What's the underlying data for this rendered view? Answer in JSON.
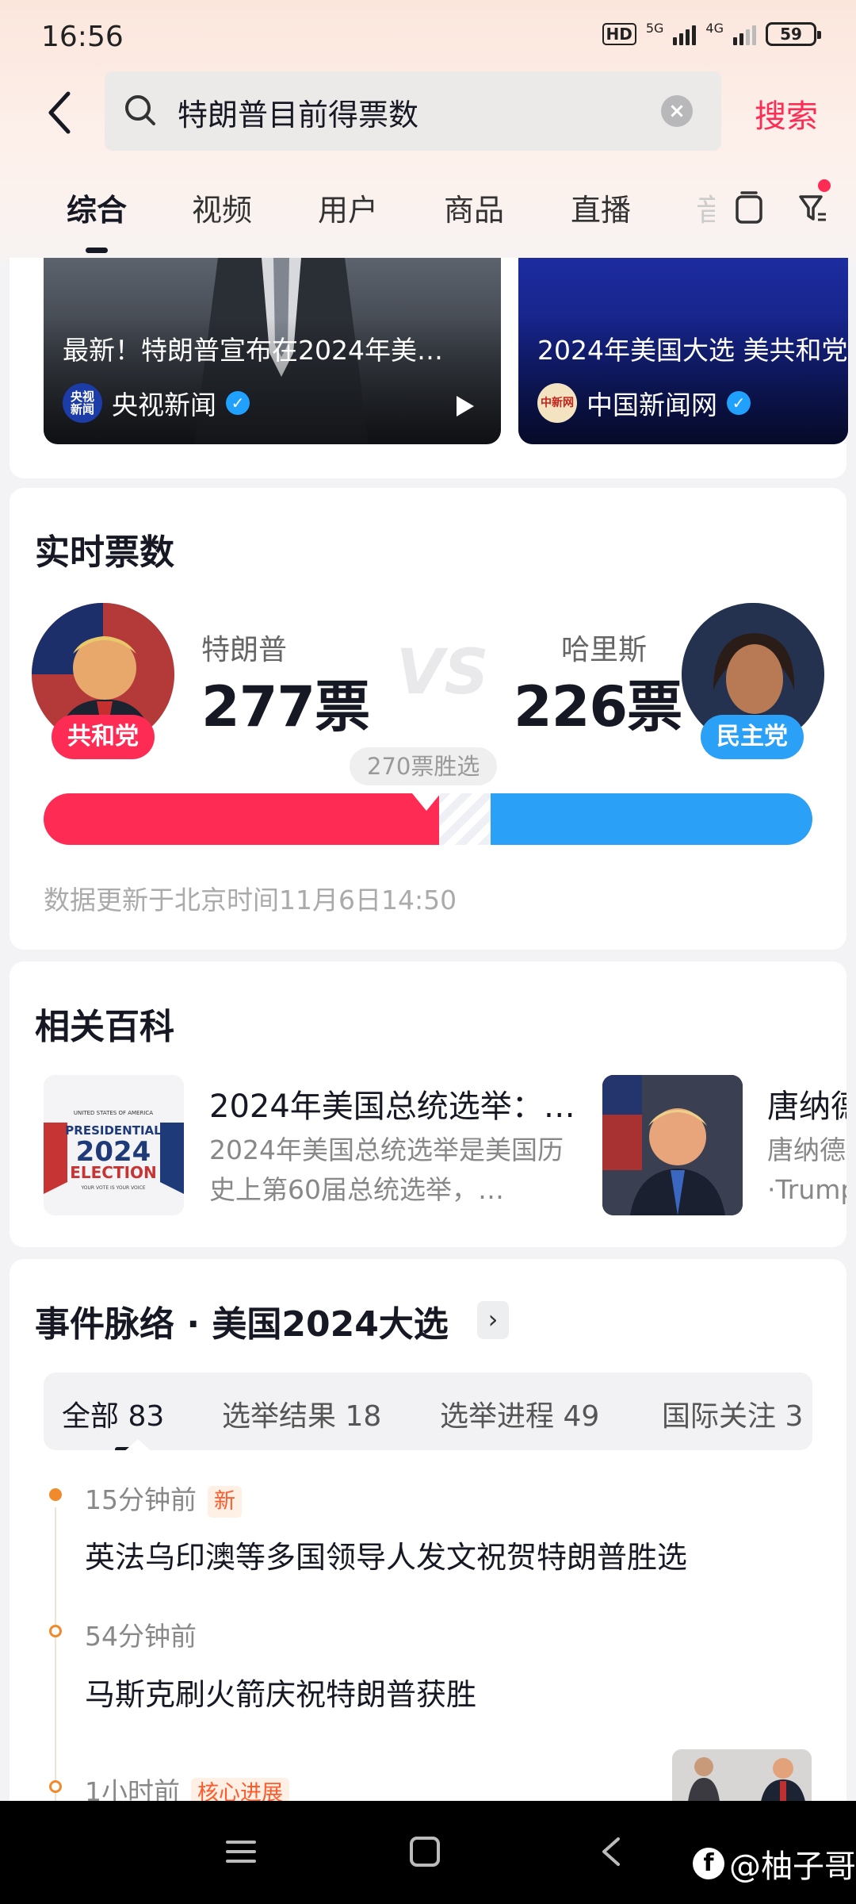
{
  "status": {
    "time": "16:56",
    "hd": "HD",
    "net1": "5G",
    "net2": "4G",
    "battery": "59"
  },
  "search": {
    "query": "特朗普目前得票数",
    "button": "搜索"
  },
  "tabs": [
    "综合",
    "视频",
    "用户",
    "商品",
    "直播",
    "音"
  ],
  "videos": [
    {
      "title": "最新！特朗普宣布在2024年美…",
      "source": "央视新闻",
      "logo_text": "央视\n新闻"
    },
    {
      "title": "2024年美国大选 美共和党",
      "source": "中国新闻网",
      "logo_text": "中新网"
    }
  ],
  "votes": {
    "section_title": "实时票数",
    "left": {
      "name": "特朗普",
      "count": "277票",
      "party": "共和党"
    },
    "right": {
      "name": "哈里斯",
      "count": "226票",
      "party": "民主党"
    },
    "vs": "VS",
    "threshold": "270票胜选",
    "updated": "数据更新于北京时间11月6日14:50",
    "left_value": 277,
    "right_value": 226,
    "total": 538,
    "colors": {
      "left": "#fe2c55",
      "right": "#2aa0f7"
    }
  },
  "baike": {
    "section_title": "相关百科",
    "items": [
      {
        "title": "2024年美国总统选举：…",
        "desc": "2024年美国总统选举是美国历史上第60届总统选举，…",
        "img_top": "UNITED STATES OF AMERICA",
        "img_main1": "PRESIDENTIAL",
        "img_main2": "2024",
        "img_main3": "ELECTION",
        "img_bottom": "YOUR VOTE IS YOUR VOICE"
      },
      {
        "title": "唐纳德",
        "desc": "唐纳德·Trump"
      }
    ]
  },
  "timeline": {
    "section_title": "事件脉络 · 美国2024大选",
    "filters": [
      {
        "label": "全部 83"
      },
      {
        "label": "选举结果 18"
      },
      {
        "label": "选举进程 49"
      },
      {
        "label": "国际关注 3"
      }
    ],
    "items": [
      {
        "time": "15分钟前",
        "tag": "新",
        "text": "英法乌印澳等多国领导人发文祝贺特朗普胜选"
      },
      {
        "time": "54分钟前",
        "tag": "",
        "text": "马斯克刷火箭庆祝特朗普获胜"
      },
      {
        "time": "1小时前",
        "tag": "核心进展",
        "text": ""
      }
    ]
  },
  "watermark": "@柚子哥"
}
